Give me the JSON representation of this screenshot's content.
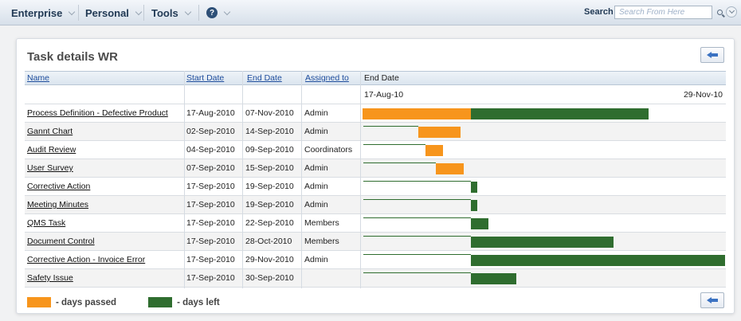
{
  "nav": {
    "items": [
      {
        "label": "Enterprise"
      },
      {
        "label": "Personal"
      },
      {
        "label": "Tools"
      }
    ],
    "help_icon": "help-icon",
    "search_label": "Search",
    "search_placeholder": "Search From Here",
    "search_icon": "magnifier-icon"
  },
  "panel": {
    "title": "Task details WR",
    "back_icon": "back-arrow-icon"
  },
  "table": {
    "columns": [
      "Name",
      "Start Date",
      "End Date",
      "Assigned to",
      "End Date"
    ],
    "timeline_start": "17-Aug-10",
    "timeline_end": "29-Nov-10",
    "rows": [
      {
        "name": "Process Definition - Defective Product",
        "start": "17-Aug-2010",
        "end": "07-Nov-2010",
        "assigned": "Admin"
      },
      {
        "name": "Gannt Chart",
        "start": "02-Sep-2010",
        "end": "14-Sep-2010",
        "assigned": "Admin"
      },
      {
        "name": "Audit Review",
        "start": "04-Sep-2010",
        "end": "09-Sep-2010",
        "assigned": "Coordinators"
      },
      {
        "name": "User Survey",
        "start": "07-Sep-2010",
        "end": "15-Sep-2010",
        "assigned": "Admin"
      },
      {
        "name": "Corrective Action",
        "start": "17-Sep-2010",
        "end": "19-Sep-2010",
        "assigned": "Admin"
      },
      {
        "name": "Meeting Minutes",
        "start": "17-Sep-2010",
        "end": "19-Sep-2010",
        "assigned": "Admin"
      },
      {
        "name": "QMS Task",
        "start": "17-Sep-2010",
        "end": "22-Sep-2010",
        "assigned": "Members"
      },
      {
        "name": "Document Control",
        "start": "17-Sep-2010",
        "end": "28-Oct-2010",
        "assigned": "Members"
      },
      {
        "name": "Corrective Action - Invoice Error",
        "start": "17-Sep-2010",
        "end": "29-Nov-2010",
        "assigned": "Admin"
      },
      {
        "name": "Safety Issue",
        "start": "17-Sep-2010",
        "end": "30-Sep-2010",
        "assigned": ""
      }
    ]
  },
  "legend": {
    "passed_label": "- days passed",
    "left_label": "- days left"
  },
  "colors": {
    "days_passed": "#f7951c",
    "days_left": "#2f6d2f",
    "link": "#1d4c9c"
  }
}
